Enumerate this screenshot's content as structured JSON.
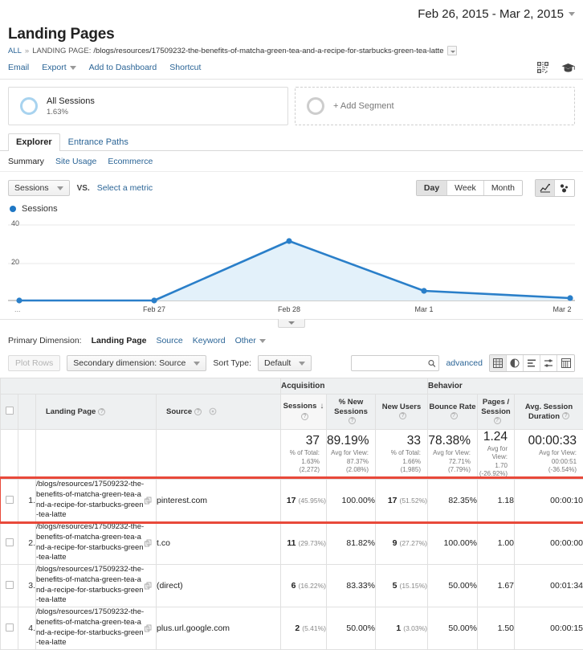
{
  "header": {
    "date_range": "Feb 26, 2015 - Mar 2, 2015",
    "title": "Landing Pages",
    "breadcrumb_all": "ALL",
    "breadcrumb_separator": "»",
    "breadcrumb_dimension_label": "LANDING PAGE:",
    "breadcrumb_value": "/blogs/resources/17509232-the-benefits-of-matcha-green-tea-and-a-recipe-for-starbucks-green-tea-latte"
  },
  "actionbar": {
    "email": "Email",
    "export": "Export",
    "add_to_dashboard": "Add to Dashboard",
    "shortcut": "Shortcut",
    "qr_icon": "qr-code-icon",
    "academy_icon": "graduation-cap-icon"
  },
  "segments": {
    "all_sessions_name": "All Sessions",
    "all_sessions_pct": "1.63%",
    "add_segment": "+ Add Segment"
  },
  "tabs": [
    {
      "label": "Explorer",
      "active": true
    },
    {
      "label": "Entrance Paths",
      "active": false
    }
  ],
  "subtabs": [
    {
      "label": "Summary",
      "active": true
    },
    {
      "label": "Site Usage",
      "active": false
    },
    {
      "label": "Ecommerce",
      "active": false
    }
  ],
  "metricrow": {
    "metric_selected": "Sessions",
    "vs_label": "VS.",
    "select_metric": "Select a metric",
    "granularity": [
      {
        "label": "Day",
        "active": true
      },
      {
        "label": "Week",
        "active": false
      },
      {
        "label": "Month",
        "active": false
      }
    ],
    "chart_type_line_icon": "line-chart-icon",
    "chart_type_motion_icon": "motion-chart-icon"
  },
  "legend": {
    "label": "Sessions",
    "color": "#1f77c4"
  },
  "chart_data": {
    "type": "line",
    "title": "Sessions",
    "xlabel": "",
    "ylabel": "Sessions",
    "x": [
      "",
      "Feb 27",
      "Feb 28",
      "Mar 1",
      "Mar 2"
    ],
    "tick_labels": [
      "...",
      "Feb 27",
      "Feb 28",
      "Mar 1",
      "Mar 2"
    ],
    "values": [
      0,
      0,
      31,
      5,
      1
    ],
    "series": [
      {
        "name": "Sessions",
        "values": [
          0,
          0,
          31,
          5,
          1
        ],
        "color": "#1f77c4"
      }
    ],
    "ylim": [
      0,
      44
    ],
    "y_ticks": [
      20,
      40
    ],
    "y_tick_labels": [
      "20",
      "40"
    ],
    "grid": true,
    "legend_position": "top-left",
    "area_fill": "#e3f1fa"
  },
  "primary_dimension": {
    "lead": "Primary Dimension:",
    "current": "Landing Page",
    "links": [
      "Source",
      "Keyword",
      "Other"
    ]
  },
  "toolrow": {
    "plot_rows": "Plot Rows",
    "secondary_dimension": "Secondary dimension: Source",
    "sort_type_label": "Sort Type:",
    "sort_type_value": "Default",
    "search_value": "",
    "search_placeholder": "",
    "search_icon": "search-icon",
    "advanced": "advanced",
    "view_icons": [
      {
        "name": "table-view-icon",
        "active": true
      },
      {
        "name": "pie-chart-view-icon",
        "active": false
      },
      {
        "name": "performance-view-icon",
        "active": false
      },
      {
        "name": "comparison-view-icon",
        "active": false
      },
      {
        "name": "pivot-view-icon",
        "active": false
      }
    ]
  },
  "table": {
    "group_headers": [
      {
        "label": "Acquisition"
      },
      {
        "label": "Behavior"
      }
    ],
    "columns": [
      {
        "key": "landing_page",
        "label": "Landing Page",
        "help": true
      },
      {
        "key": "source",
        "label": "Source",
        "help": true,
        "gear": true
      },
      {
        "key": "sessions",
        "label": "Sessions",
        "help": true,
        "sorted": true,
        "sort_dir": "↓"
      },
      {
        "key": "pct_new_sessions",
        "label": "% New Sessions",
        "help": true
      },
      {
        "key": "new_users",
        "label": "New Users",
        "help": true
      },
      {
        "key": "bounce_rate",
        "label": "Bounce Rate",
        "help": true
      },
      {
        "key": "pages_session",
        "label": "Pages / Session",
        "help": true
      },
      {
        "key": "avg_session_duration",
        "label": "Avg. Session Duration",
        "help": true
      }
    ],
    "totals": {
      "sessions": {
        "main": "37",
        "sub": [
          "% of Total:",
          "1.63% (2,272)"
        ]
      },
      "pct_new_sessions": {
        "main": "89.19%",
        "sub": [
          "Avg for View:",
          "87.37%",
          "(2.08%)"
        ]
      },
      "new_users": {
        "main": "33",
        "sub": [
          "% of Total:",
          "1.66%",
          "(1,985)"
        ]
      },
      "bounce_rate": {
        "main": "78.38%",
        "sub": [
          "Avg for View:",
          "72.71%",
          "(7.79%)"
        ]
      },
      "pages_session": {
        "main": "1.24",
        "sub": [
          "Avg for",
          "View:",
          "1.70",
          "(-26.92%)"
        ]
      },
      "avg_session_duration": {
        "main": "00:00:33",
        "sub": [
          "Avg for View:",
          "00:00:51",
          "(-36.54%)"
        ]
      }
    },
    "rows": [
      {
        "index": "1.",
        "landing_page": "/blogs/resources/17509232-the-benefits-of-matcha-green-tea-and-a-recipe-for-starbucks-green-tea-latte",
        "source": "pinterest.com",
        "sessions": "17",
        "sessions_pct": "(45.95%)",
        "pct_new_sessions": "100.00%",
        "new_users": "17",
        "new_users_pct": "(51.52%)",
        "bounce_rate": "82.35%",
        "pages_session": "1.18",
        "avg_session_duration": "00:00:10",
        "highlighted": true
      },
      {
        "index": "2.",
        "landing_page": "/blogs/resources/17509232-the-benefits-of-matcha-green-tea-and-a-recipe-for-starbucks-green-tea-latte",
        "source": "t.co",
        "sessions": "11",
        "sessions_pct": "(29.73%)",
        "pct_new_sessions": "81.82%",
        "new_users": "9",
        "new_users_pct": "(27.27%)",
        "bounce_rate": "100.00%",
        "pages_session": "1.00",
        "avg_session_duration": "00:00:00",
        "highlighted": false
      },
      {
        "index": "3.",
        "landing_page": "/blogs/resources/17509232-the-benefits-of-matcha-green-tea-and-a-recipe-for-starbucks-green-tea-latte",
        "source": "(direct)",
        "sessions": "6",
        "sessions_pct": "(16.22%)",
        "pct_new_sessions": "83.33%",
        "new_users": "5",
        "new_users_pct": "(15.15%)",
        "bounce_rate": "50.00%",
        "pages_session": "1.67",
        "avg_session_duration": "00:01:34",
        "highlighted": false
      },
      {
        "index": "4.",
        "landing_page": "/blogs/resources/17509232-the-benefits-of-matcha-green-tea-and-a-recipe-for-starbucks-green-tea-latte",
        "source": "plus.url.google.com",
        "sessions": "2",
        "sessions_pct": "(5.41%)",
        "pct_new_sessions": "50.00%",
        "new_users": "1",
        "new_users_pct": "(3.03%)",
        "bounce_rate": "50.00%",
        "pages_session": "1.50",
        "avg_session_duration": "00:00:15",
        "highlighted": false
      }
    ]
  }
}
